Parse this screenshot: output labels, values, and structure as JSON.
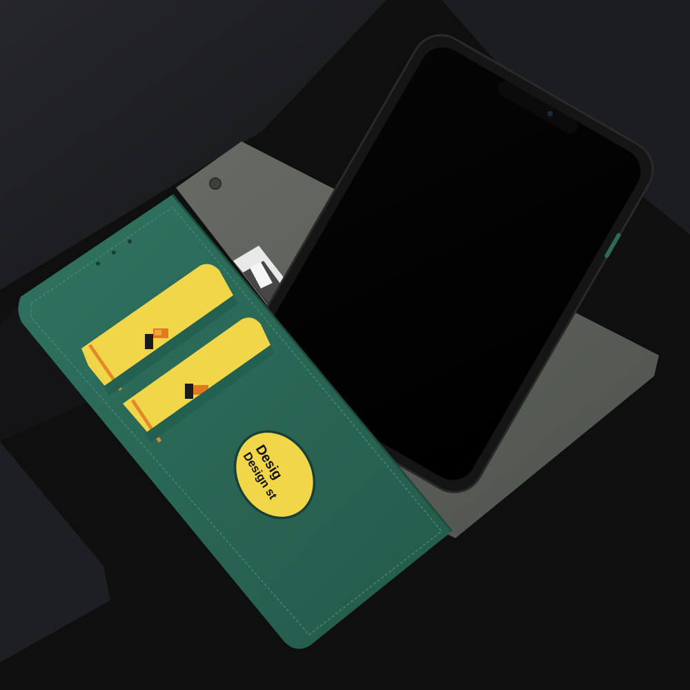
{
  "colors": {
    "background": "#101010",
    "backdrop_box": "#1b1c1f",
    "case_leather_green": "#2c6a58",
    "case_inner_grey": "#5e625c",
    "card_yellow": "#f1d64a",
    "card_stripe_orange": "#e08a2a",
    "phone_bumper": "#141414",
    "phone_screen": "#000000"
  },
  "window_card": {
    "line1": "Desig",
    "line2": "Design st"
  },
  "icons": [
    "phone-camera-icon",
    "magnetic-clasp-icon",
    "card-pixel-art-icon"
  ]
}
